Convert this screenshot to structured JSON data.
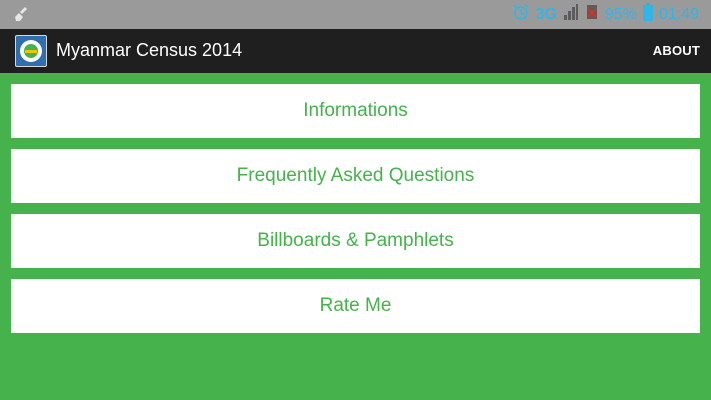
{
  "status_bar": {
    "signal": "3G",
    "battery": "95%",
    "time": "01:49",
    "icons": [
      "broom-icon",
      "alarm-icon",
      "signal-bars-icon",
      "x-icon",
      "battery-icon"
    ]
  },
  "action_bar": {
    "title": "Myanmar Census 2014",
    "about_label": "ABOUT",
    "app_icon": "census-logo-icon"
  },
  "menu": {
    "items": [
      {
        "label": "Informations"
      },
      {
        "label": "Frequently Asked Questions"
      },
      {
        "label": "Billboards & Pamphlets"
      },
      {
        "label": "Rate Me"
      }
    ]
  },
  "colors": {
    "accent": "#45b24b",
    "status_icons": "#31b5e6",
    "action_bar": "#1f1f1f",
    "status_bar": "#9a9a9a"
  }
}
